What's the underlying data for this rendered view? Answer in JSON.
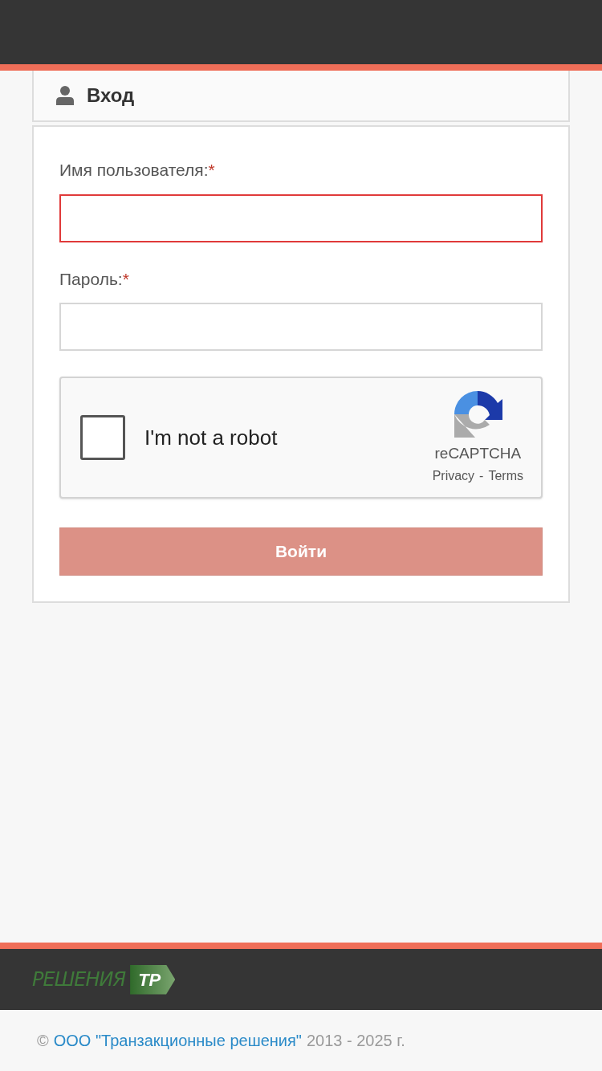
{
  "login_panel": {
    "title": "Вход",
    "fields": [
      {
        "label": "Имя пользователя:",
        "required_mark": "*",
        "invalid": true
      },
      {
        "label": "Пароль:",
        "required_mark": "*",
        "invalid": false
      }
    ],
    "captcha": {
      "checked": false,
      "label": "I'm not a robot",
      "brand": "reCAPTCHA",
      "privacy": "Privacy",
      "separator": "-",
      "terms": "Terms"
    },
    "submit": {
      "label": "Войти",
      "disabled": true
    }
  },
  "footer": {
    "logo": {
      "word": "РЕШЕНИЯ",
      "mark": "ТР"
    },
    "copyright_sign": "©",
    "company_link": "ООО \"Транзакционные решения\"",
    "years": "2013 -  2025 г."
  }
}
